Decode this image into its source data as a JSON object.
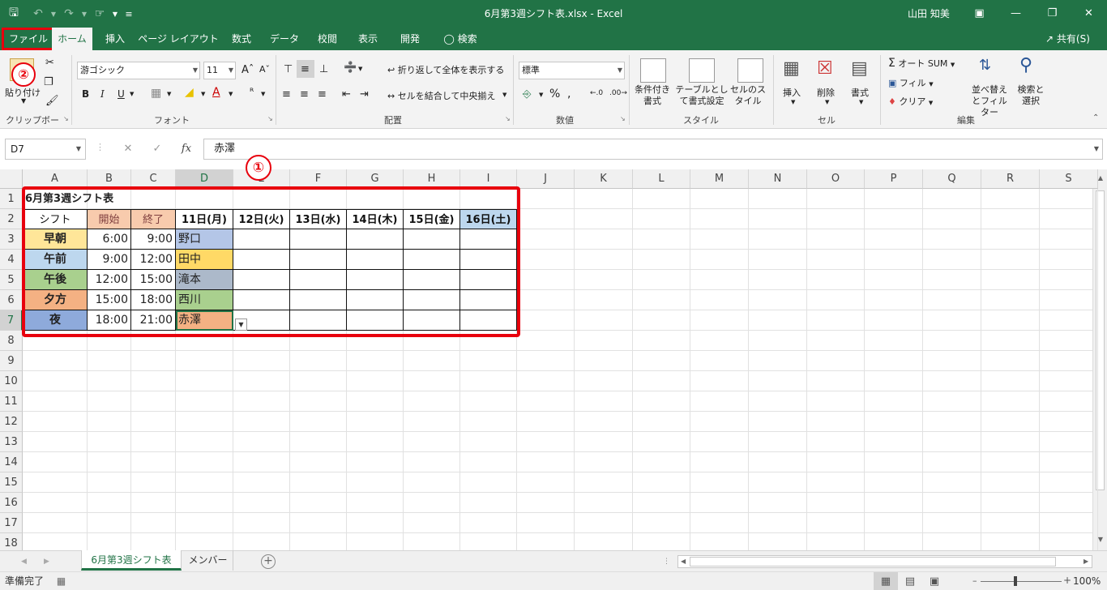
{
  "window": {
    "title": "6月第3週シフト表.xlsx - Excel",
    "user": "山田 知美",
    "qat_icons": [
      "save-icon",
      "undo-icon",
      "redo-icon",
      "touch-mode-icon",
      "customize-icon"
    ]
  },
  "tabs": [
    "ファイル",
    "ホーム",
    "挿入",
    "ページ レイアウト",
    "数式",
    "データ",
    "校閲",
    "表示",
    "開発",
    "検索"
  ],
  "share_label": "共有(S)",
  "ribbon": {
    "clipboard": {
      "paste": "貼り付け",
      "label": "クリップボード"
    },
    "font": {
      "name": "游ゴシック",
      "size": "11",
      "bold": "B",
      "italic": "I",
      "underline": "U",
      "label": "フォント"
    },
    "alignment": {
      "wrap": "折り返して全体を表示する",
      "merge": "セルを結合して中央揃え",
      "label": "配置"
    },
    "number": {
      "format": "標準",
      "percent": "%",
      "label": "数値"
    },
    "styles": {
      "conditional": "条件付き書式",
      "table": "テーブルとして書式設定",
      "cell_style": "セルのスタイル",
      "label": "スタイル"
    },
    "cells": {
      "insert": "挿入",
      "delete": "削除",
      "format": "書式",
      "label": "セル"
    },
    "editing": {
      "autosum": "オート SUM",
      "fill": "フィル",
      "clear": "クリア",
      "sort": "並べ替えとフィルター",
      "find": "検索と選択",
      "label": "編集"
    }
  },
  "formula_bar": {
    "name_box": "D7",
    "content": "赤澤",
    "fx": "fx"
  },
  "annotations": {
    "one": "①",
    "two": "②"
  },
  "columns": [
    "A",
    "B",
    "C",
    "D",
    "E",
    "F",
    "G",
    "H",
    "I",
    "J",
    "K",
    "L",
    "M",
    "N",
    "O",
    "P",
    "Q",
    "R",
    "S"
  ],
  "rows": [
    "1",
    "2",
    "3",
    "4",
    "5",
    "6",
    "7",
    "8",
    "9",
    "10",
    "11",
    "12",
    "13",
    "14",
    "15",
    "16",
    "17",
    "18"
  ],
  "sheet": {
    "title": "6月第3週シフト表",
    "headers": [
      "シフト",
      "開始",
      "終了",
      "11日(月)",
      "12日(火)",
      "13日(水)",
      "14日(木)",
      "15日(金)",
      "16日(土)"
    ],
    "shifts": [
      {
        "name": "早朝",
        "start": "6:00",
        "end": "9:00",
        "staff": "野口",
        "shift_color": "#ffe699",
        "staff_color": "#b4c6e7"
      },
      {
        "name": "午前",
        "start": "9:00",
        "end": "12:00",
        "staff": "田中",
        "shift_color": "#bdd7ee",
        "staff_color": "#ffd966"
      },
      {
        "name": "午後",
        "start": "12:00",
        "end": "15:00",
        "staff": "滝本",
        "shift_color": "#a9d08e",
        "staff_color": "#acb9ca"
      },
      {
        "name": "夕方",
        "start": "15:00",
        "end": "18:00",
        "staff": "西川",
        "shift_color": "#f4b183",
        "staff_color": "#a9d08e"
      },
      {
        "name": "夜",
        "start": "18:00",
        "end": "21:00",
        "staff": "赤澤",
        "shift_color": "#8eaadb",
        "staff_color": "#f4b183"
      }
    ]
  },
  "sheet_tabs": [
    "6月第3週シフト表",
    "メンバー"
  ],
  "status": {
    "ready": "準備完了",
    "zoom": "100%"
  },
  "colors": {
    "brand": "#217346",
    "highlight": "#e8000d"
  }
}
